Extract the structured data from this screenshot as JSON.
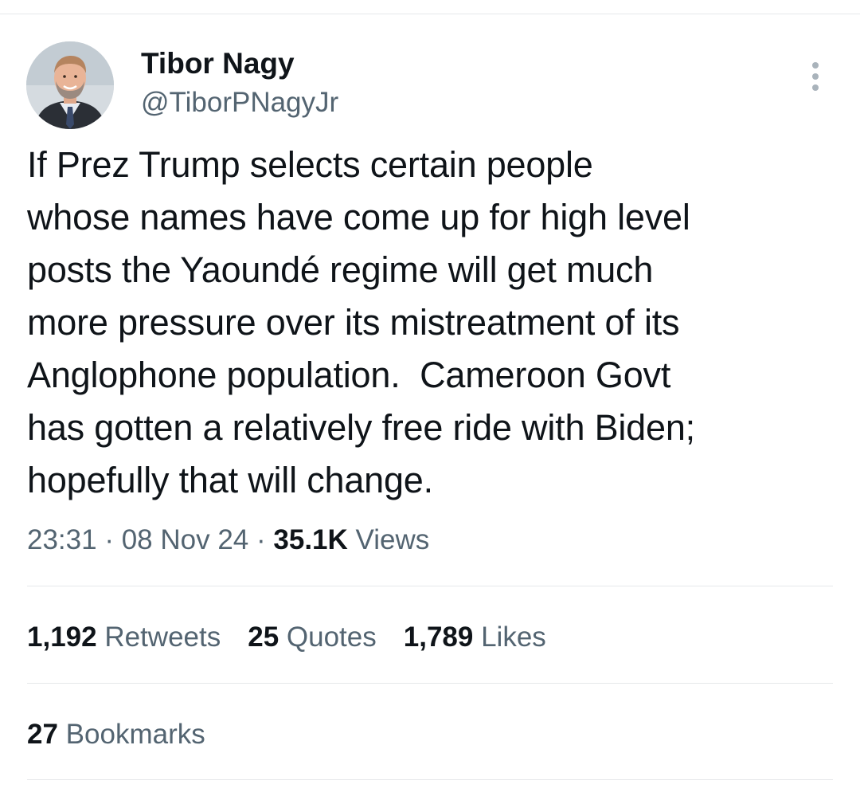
{
  "author": {
    "display_name": "Tibor Nagy",
    "handle": "@TiborPNagyJr"
  },
  "tweet": {
    "text": "If Prez Trump selects certain people\nwhose names have come up for high level\nposts the Yaoundé regime will get much\nmore pressure over its mistreatment of its\nAnglophone population.  Cameroon Govt\nhas gotten a relatively free ride with Biden;\nhopefully that will change.",
    "time": "23:31",
    "separator": "·",
    "date": "08 Nov 24",
    "views_count": "35.1K",
    "views_label": "Views"
  },
  "stats": {
    "retweets": {
      "count": "1,192",
      "label": "Retweets"
    },
    "quotes": {
      "count": "25",
      "label": "Quotes"
    },
    "likes": {
      "count": "1,789",
      "label": "Likes"
    },
    "bookmarks": {
      "count": "27",
      "label": "Bookmarks"
    }
  },
  "icons": {
    "more": "more-vertical-icon"
  },
  "colors": {
    "text_primary": "#0f1419",
    "text_secondary": "#536471",
    "divider": "#e6e8ea",
    "background": "#ffffff"
  }
}
